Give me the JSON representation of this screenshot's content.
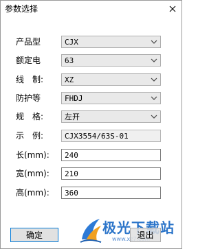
{
  "window": {
    "title": "参数选择"
  },
  "form": {
    "product_type": {
      "label": "产品型",
      "value": "CJX"
    },
    "rated_current": {
      "label": "额定电",
      "value": "63"
    },
    "wiring": {
      "label": "线　制:",
      "value": "XZ"
    },
    "protection": {
      "label": "防护等",
      "value": "FHDJ"
    },
    "spec": {
      "label": "规　格:",
      "value": "左开"
    },
    "example": {
      "label": "示　例:",
      "value": "CJX3554/63S-01"
    },
    "length": {
      "label": "长(mm):",
      "value": "240"
    },
    "width": {
      "label": "宽(mm):",
      "value": "210"
    },
    "height": {
      "label": "高(mm):",
      "value": "360"
    }
  },
  "buttons": {
    "ok": "确定",
    "exit": "退出"
  },
  "watermark": {
    "text": "极光下载站",
    "url": "www.xz7.com"
  }
}
